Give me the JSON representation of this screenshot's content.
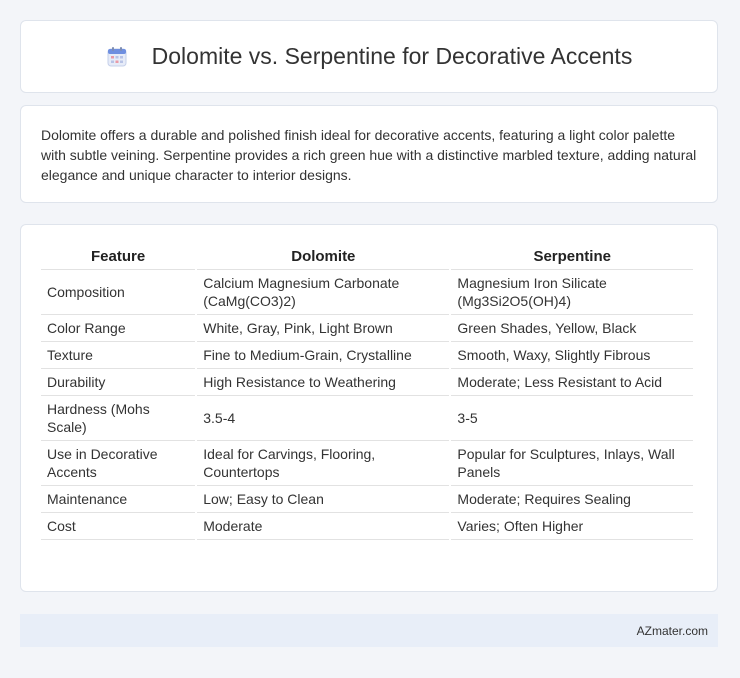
{
  "page": {
    "title": "Dolomite vs. Serpentine for Decorative Accents",
    "icon": "calendar-icon",
    "intro": "Dolomite offers a durable and polished finish ideal for decorative accents, featuring a light color palette with subtle veining. Serpentine provides a rich green hue with a distinctive marbled texture, adding natural elegance and unique character to interior designs."
  },
  "table": {
    "headers": [
      "Feature",
      "Dolomite",
      "Serpentine"
    ],
    "rows": [
      [
        "Composition",
        "Calcium Magnesium Carbonate (CaMg(CO3)2)",
        "Magnesium Iron Silicate (Mg3Si2O5(OH)4)"
      ],
      [
        "Color Range",
        "White, Gray, Pink, Light Brown",
        "Green Shades, Yellow, Black"
      ],
      [
        "Texture",
        "Fine to Medium-Grain, Crystalline",
        "Smooth, Waxy, Slightly Fibrous"
      ],
      [
        "Durability",
        "High Resistance to Weathering",
        "Moderate; Less Resistant to Acid"
      ],
      [
        "Hardness (Mohs Scale)",
        "3.5-4",
        "3-5"
      ],
      [
        "Use in Decorative Accents",
        "Ideal for Carvings, Flooring, Countertops",
        "Popular for Sculptures, Inlays, Wall Panels"
      ],
      [
        "Maintenance",
        "Low; Easy to Clean",
        "Moderate; Requires Sealing"
      ],
      [
        "Cost",
        "Moderate",
        "Varies; Often Higher"
      ]
    ]
  },
  "footer": {
    "brand": "AZmater.com"
  }
}
